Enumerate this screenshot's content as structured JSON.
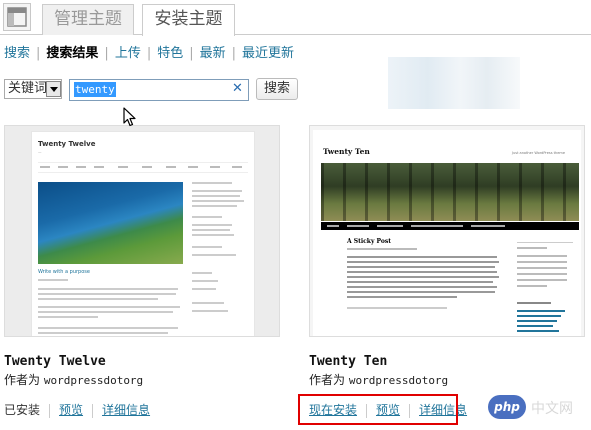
{
  "tabs": [
    {
      "label": "管理主题",
      "active": false
    },
    {
      "label": "安装主题",
      "active": true
    }
  ],
  "subnav": [
    {
      "label": "搜索",
      "current": false
    },
    {
      "label": "搜索结果",
      "current": true
    },
    {
      "label": "上传",
      "current": false
    },
    {
      "label": "特色",
      "current": false
    },
    {
      "label": "最新",
      "current": false
    },
    {
      "label": "最近更新",
      "current": false
    }
  ],
  "search": {
    "type_select": "关键词",
    "query": "twenty",
    "button_label": "搜索"
  },
  "themes": [
    {
      "name": "Twenty Twelve",
      "author_prefix": "作者为",
      "author": "wordpressdotorg",
      "status_label": "已安装",
      "preview_label": "预览",
      "details_label": "详细信息",
      "thumb": {
        "site_title": "Twenty Twelve",
        "post_link": "Write with a purpose"
      }
    },
    {
      "name": "Twenty Ten",
      "author_prefix": "作者为",
      "author": "wordpressdotorg",
      "install_label": "现在安装",
      "preview_label": "预览",
      "details_label": "详细信息",
      "thumb": {
        "site_title": "Twenty Ten",
        "tagline": "Just another WordPress theme",
        "post_title": "A Sticky Post"
      }
    }
  ],
  "watermark": {
    "logo": "php",
    "text": "中文网"
  },
  "colors": {
    "link": "#21759b",
    "highlight_border": "#e00000",
    "selection": "#3399ff"
  }
}
